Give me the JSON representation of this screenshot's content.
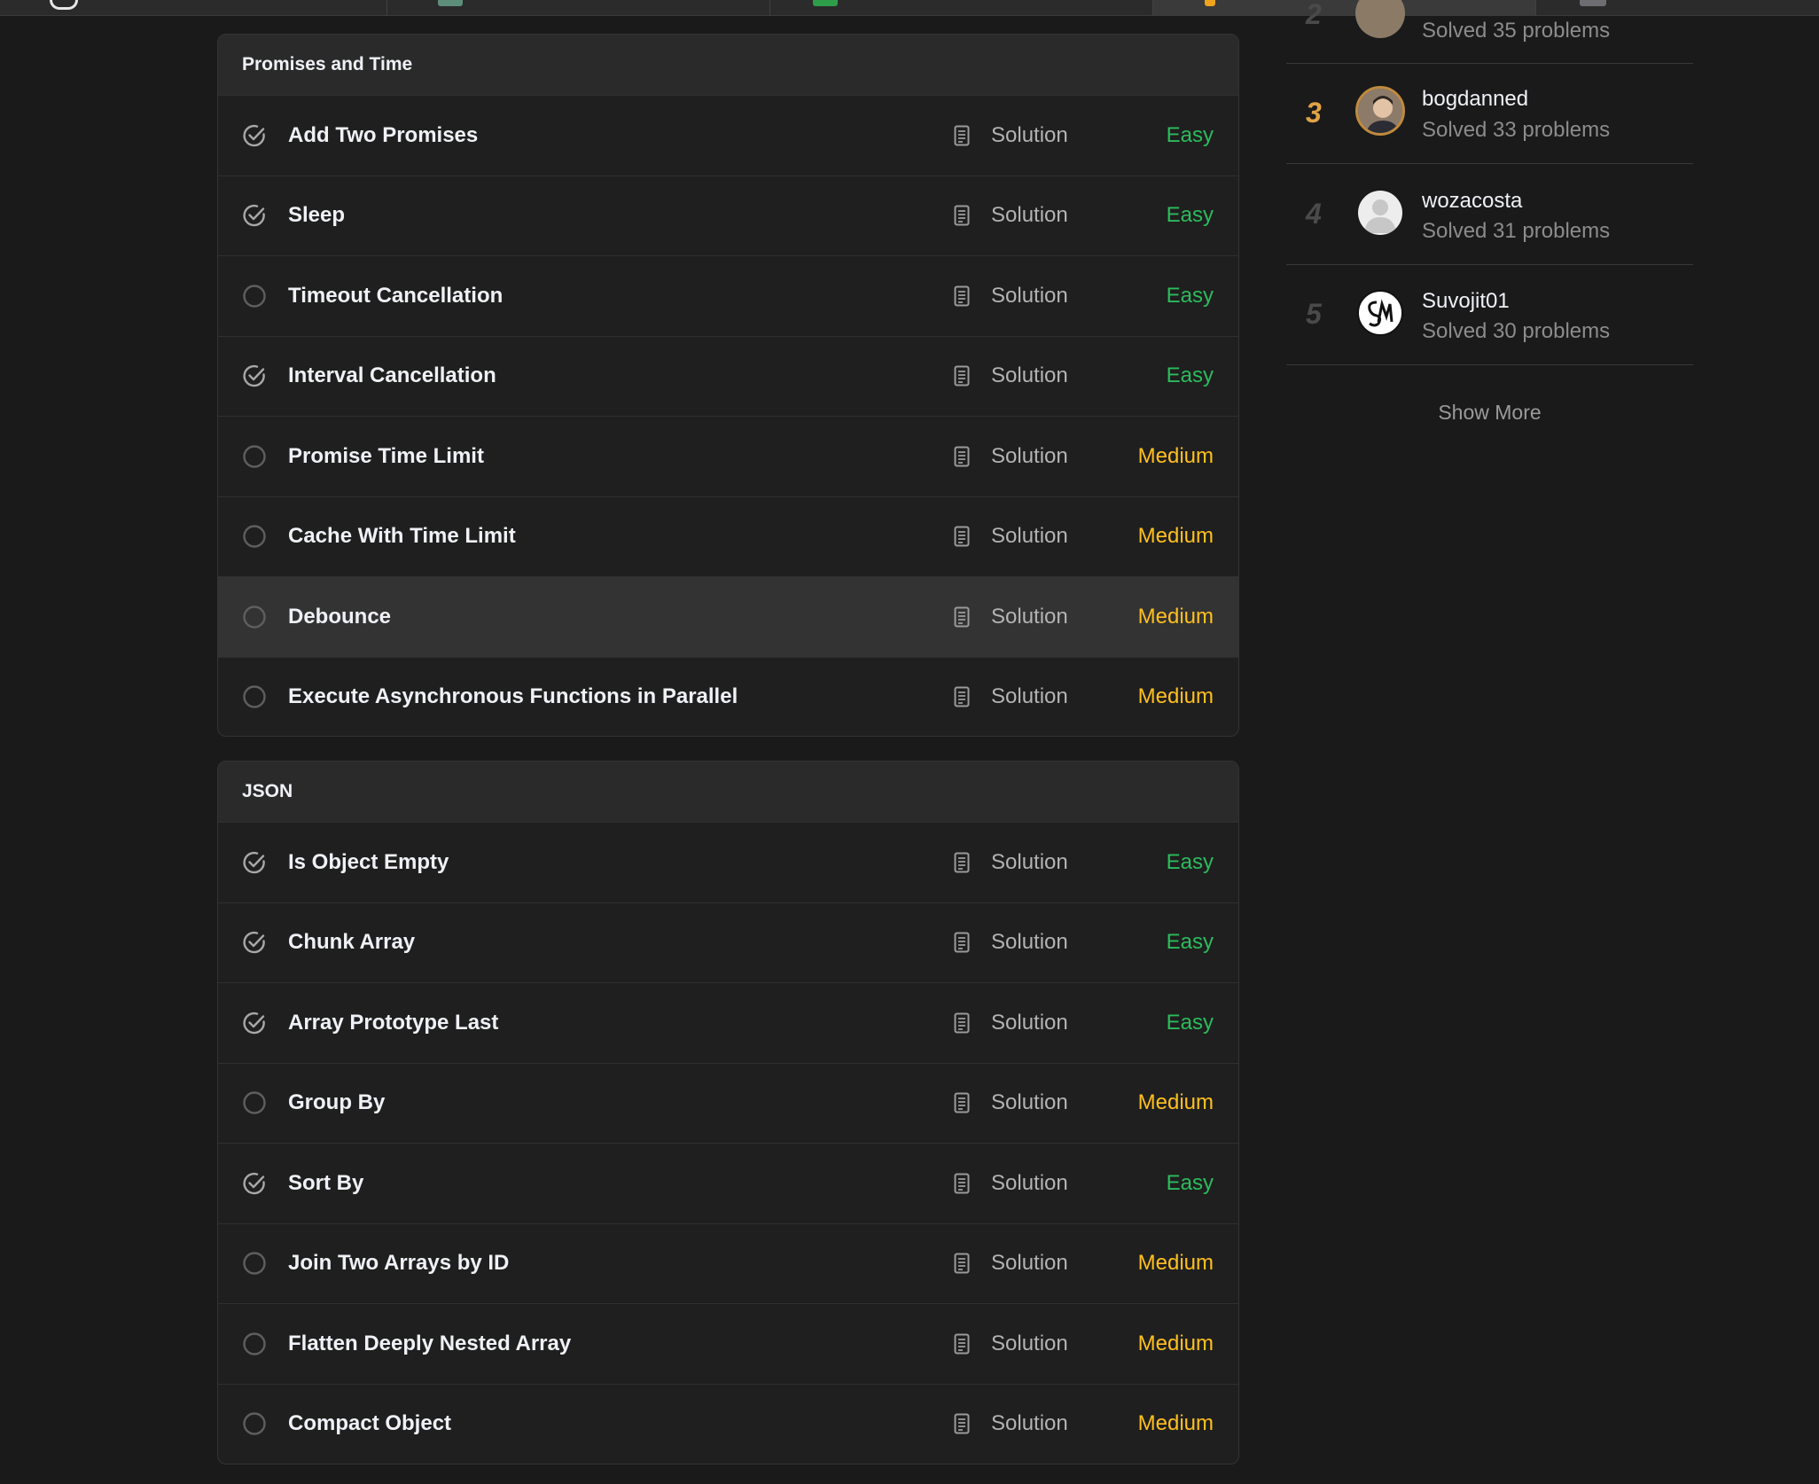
{
  "sections": [
    {
      "name": "Promises and Time",
      "rows": [
        {
          "title": "Add Two Promises",
          "solution": "Solution",
          "difficulty": "Easy",
          "solved": true
        },
        {
          "title": "Sleep",
          "solution": "Solution",
          "difficulty": "Easy",
          "solved": true
        },
        {
          "title": "Timeout Cancellation",
          "solution": "Solution",
          "difficulty": "Easy",
          "solved": false
        },
        {
          "title": "Interval Cancellation",
          "solution": "Solution",
          "difficulty": "Easy",
          "solved": true
        },
        {
          "title": "Promise Time Limit",
          "solution": "Solution",
          "difficulty": "Medium",
          "solved": false
        },
        {
          "title": "Cache With Time Limit",
          "solution": "Solution",
          "difficulty": "Medium",
          "solved": false
        },
        {
          "title": "Debounce",
          "solution": "Solution",
          "difficulty": "Medium",
          "solved": false
        },
        {
          "title": "Execute Asynchronous Functions in Parallel",
          "solution": "Solution",
          "difficulty": "Medium",
          "solved": false
        }
      ]
    },
    {
      "name": "JSON",
      "rows": [
        {
          "title": "Is Object Empty",
          "solution": "Solution",
          "difficulty": "Easy",
          "solved": true
        },
        {
          "title": "Chunk Array",
          "solution": "Solution",
          "difficulty": "Easy",
          "solved": true
        },
        {
          "title": "Array Prototype Last",
          "solution": "Solution",
          "difficulty": "Easy",
          "solved": true
        },
        {
          "title": "Group By",
          "solution": "Solution",
          "difficulty": "Medium",
          "solved": false
        },
        {
          "title": "Sort By",
          "solution": "Solution",
          "difficulty": "Easy",
          "solved": true
        },
        {
          "title": "Join Two Arrays by ID",
          "solution": "Solution",
          "difficulty": "Medium",
          "solved": false
        },
        {
          "title": "Flatten Deeply Nested Array",
          "solution": "Solution",
          "difficulty": "Medium",
          "solved": false
        },
        {
          "title": "Compact Object",
          "solution": "Solution",
          "difficulty": "Medium",
          "solved": false
        }
      ]
    }
  ],
  "leaderboard": [
    {
      "rank": "2",
      "name": "",
      "solved": "Solved 35 problems"
    },
    {
      "rank": "3",
      "name": "bogdanned",
      "solved": "Solved 33 problems"
    },
    {
      "rank": "4",
      "name": "wozacosta",
      "solved": "Solved 31 problems"
    },
    {
      "rank": "5",
      "name": "Suvojit01",
      "solved": "Solved 30 problems"
    }
  ],
  "show_more": "Show More",
  "colors": {
    "easy": "#2cbb5d",
    "medium": "#ffc01e",
    "gold_rank": "#e0a346"
  }
}
